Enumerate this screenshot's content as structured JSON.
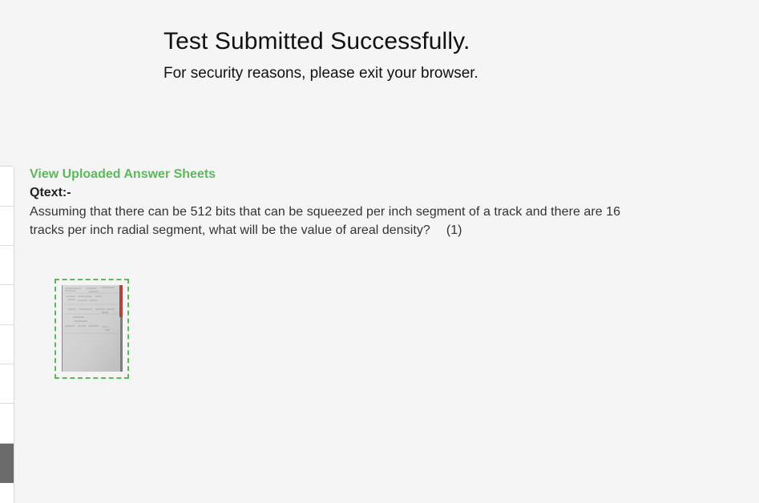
{
  "header": {
    "title": "Test Submitted Successfully.",
    "subtitle": "For security reasons, please exit your browser."
  },
  "question": {
    "view_link": "View Uploaded Answer Sheets",
    "qtext_label": "Qtext:-",
    "qtext_body": "Assuming that there can be 512 bits that can be squeezed per inch segment of a track and there are 16 tracks per inch radial segment, what will be the value of areal density?",
    "marks": "(1)"
  },
  "colors": {
    "accent": "#5cb85c",
    "background": "#f5f5f5",
    "rail_active": "#6b6b6b"
  }
}
